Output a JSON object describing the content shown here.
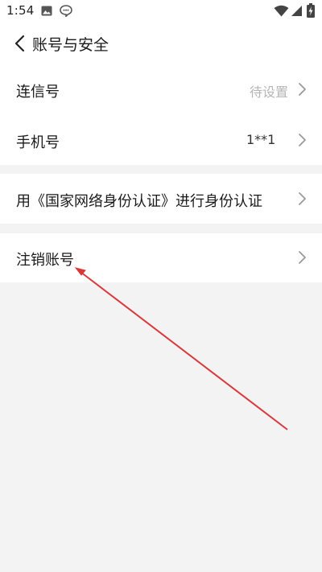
{
  "status_bar": {
    "time": "1:54",
    "icons": [
      "image-icon",
      "message-bubble-icon",
      "wifi-icon",
      "cellular-signal-icon",
      "battery-charging-icon"
    ]
  },
  "header": {
    "back_icon": "chevron-left-icon",
    "title": "账号与安全"
  },
  "account_rows": [
    {
      "label": "连信号",
      "value": "待设置"
    },
    {
      "label": "手机号",
      "value": "1**1"
    }
  ],
  "identity_row": {
    "label": "用《国家网络身份认证》进行身份认证"
  },
  "cancel_row": {
    "label": "注销账号"
  },
  "colors": {
    "page_background": "#f3f3f4",
    "row_background": "#ffffff",
    "value_text": "#b5b5b5",
    "chevron": "#9a9a9a",
    "annotation_arrow": "#d9383b"
  }
}
